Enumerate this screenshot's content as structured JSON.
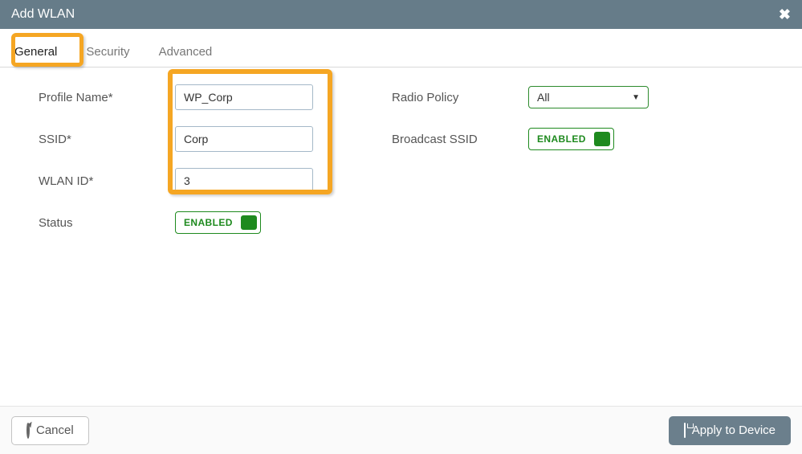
{
  "header": {
    "title": "Add WLAN"
  },
  "tabs": {
    "general": "General",
    "security": "Security",
    "advanced": "Advanced"
  },
  "form": {
    "profile_name": {
      "label": "Profile Name*",
      "value": "WP_Corp"
    },
    "ssid": {
      "label": "SSID*",
      "value": "Corp"
    },
    "wlan_id": {
      "label": "WLAN ID*",
      "value": "3"
    },
    "status": {
      "label": "Status",
      "state": "ENABLED"
    },
    "radio_policy": {
      "label": "Radio Policy",
      "value": "All"
    },
    "broadcast_ssid": {
      "label": "Broadcast SSID",
      "state": "ENABLED"
    }
  },
  "footer": {
    "cancel": "Cancel",
    "apply": "Apply to Device"
  }
}
